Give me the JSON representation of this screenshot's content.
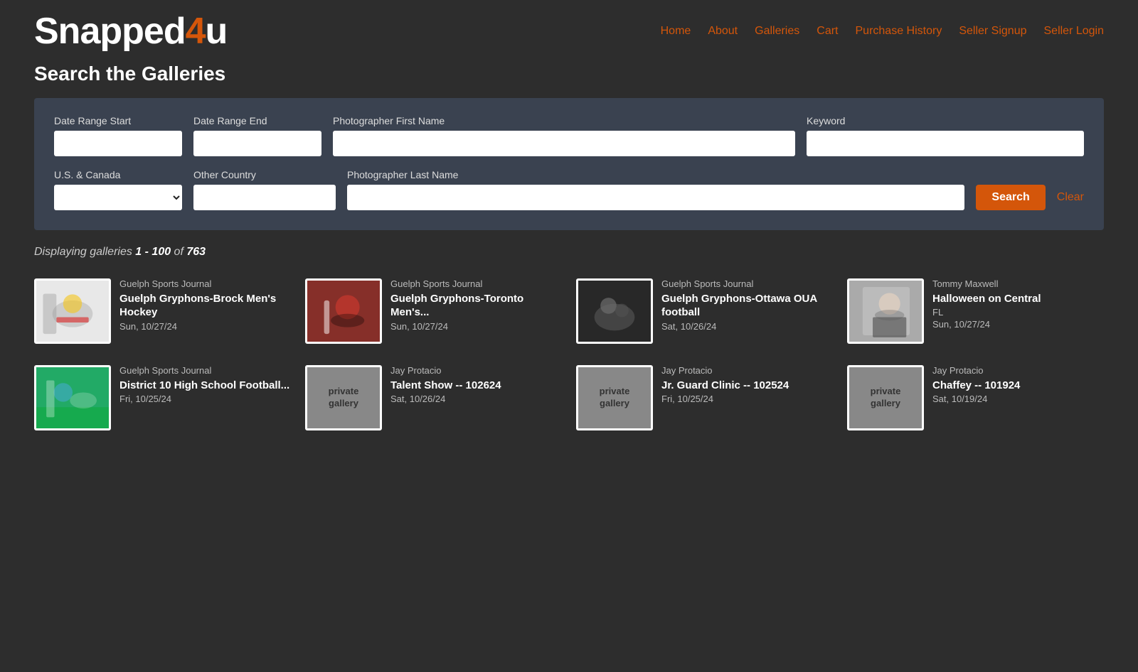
{
  "site": {
    "logo_white": "Snapped",
    "logo_orange": "4",
    "logo_u": "u"
  },
  "nav": {
    "items": [
      {
        "label": "Home",
        "href": "#"
      },
      {
        "label": "About",
        "href": "#"
      },
      {
        "label": "Galleries",
        "href": "#"
      },
      {
        "label": "Cart",
        "href": "#"
      },
      {
        "label": "Purchase History",
        "href": "#"
      },
      {
        "label": "Seller Signup",
        "href": "#"
      },
      {
        "label": "Seller Login",
        "href": "#"
      }
    ]
  },
  "page": {
    "title": "Search the Galleries"
  },
  "search": {
    "date_range_start_label": "Date Range Start",
    "date_range_end_label": "Date Range End",
    "photographer_first_name_label": "Photographer First Name",
    "keyword_label": "Keyword",
    "us_canada_label": "U.S. & Canada",
    "other_country_label": "Other Country",
    "photographer_last_name_label": "Photographer Last Name",
    "search_button": "Search",
    "clear_button": "Clear"
  },
  "results": {
    "display_text": "Displaying galleries",
    "range_start": "1",
    "range_end": "100",
    "total": "763"
  },
  "galleries": [
    {
      "photographer": "Guelph Sports Journal",
      "name": "Guelph Gryphons-Brock Men's Hockey",
      "location": "",
      "date": "Sun, 10/27/24",
      "type": "photo",
      "thumb_class": "thumb-hockey"
    },
    {
      "photographer": "Guelph Sports Journal",
      "name": "Guelph Gryphons-Toronto Men's...",
      "location": "",
      "date": "Sun, 10/27/24",
      "type": "photo",
      "thumb_class": "thumb-lacrosse"
    },
    {
      "photographer": "Guelph Sports Journal",
      "name": "Guelph Gryphons-Ottawa OUA football",
      "location": "",
      "date": "Sat, 10/26/24",
      "type": "photo",
      "thumb_class": "thumb-football"
    },
    {
      "photographer": "Tommy Maxwell",
      "name": "Halloween on Central",
      "location": "FL",
      "date": "Sun, 10/27/24",
      "type": "photo",
      "thumb_class": "thumb-halloween"
    },
    {
      "photographer": "Guelph Sports Journal",
      "name": "District 10 High School Football...",
      "location": "",
      "date": "Fri, 10/25/24",
      "type": "photo",
      "thumb_class": "thumb-districtfootball"
    },
    {
      "photographer": "Jay Protacio",
      "name": "Talent Show -- 102624",
      "location": "",
      "date": "Sat, 10/26/24",
      "type": "private"
    },
    {
      "photographer": "Jay Protacio",
      "name": "Jr. Guard Clinic -- 102524",
      "location": "",
      "date": "Fri, 10/25/24",
      "type": "private"
    },
    {
      "photographer": "Jay Protacio",
      "name": "Chaffey -- 101924",
      "location": "",
      "date": "Sat, 10/19/24",
      "type": "private"
    }
  ],
  "private_label": "private gallery"
}
